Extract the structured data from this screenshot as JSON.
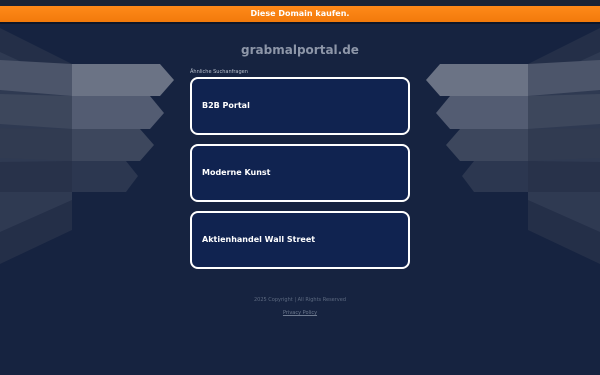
{
  "banner": {
    "label": "Diese Domain kaufen."
  },
  "header": {
    "domain": "grabmalportal.de"
  },
  "related": {
    "heading": "Ähnliche Suchanfragen",
    "items": [
      {
        "label": "B2B Portal"
      },
      {
        "label": "Moderne Kunst"
      },
      {
        "label": "Aktienhandel Wall Street"
      }
    ]
  },
  "footer": {
    "copyright": "2025 Copyright | All Rights Reserved",
    "privacy": "Privacy Policy"
  },
  "colors": {
    "background": "#162340",
    "banner": "#f58112",
    "card_background": "#102350",
    "card_border": "#ffffff"
  }
}
